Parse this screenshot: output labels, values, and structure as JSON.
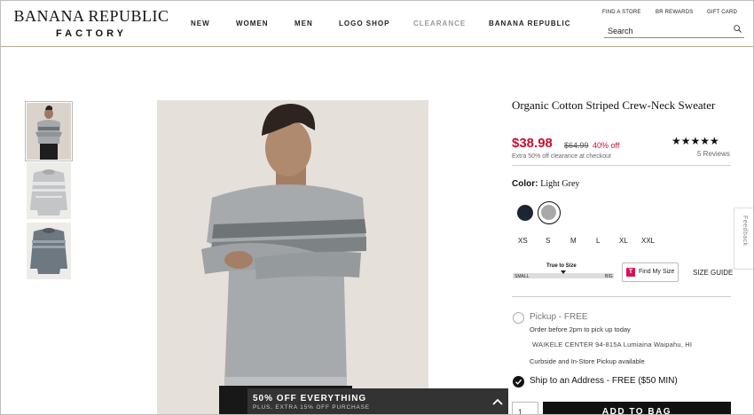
{
  "brand": {
    "line1": "BANANA REPUBLIC",
    "line2": "FACTORY"
  },
  "nav": {
    "items": [
      "NEW",
      "WOMEN",
      "MEN",
      "LOGO SHOP",
      "CLEARANCE",
      "BANANA REPUBLIC"
    ]
  },
  "utility": {
    "find_store": "FIND A STORE",
    "rewards": "BR REWARDS",
    "gift_card": "GIFT CARD"
  },
  "search": {
    "placeholder": "Search",
    "icon": "search-icon"
  },
  "product": {
    "title": "Organic Cotton Striped Crew-Neck Sweater",
    "price": "$38.98",
    "original_price": "$64.99",
    "discount": "40% off",
    "extra_offer": "Extra 50% off clearance at checkout",
    "stars": "★★★★★",
    "reviews": "5 Reviews",
    "color_label": "Color:",
    "color_value": "Light Grey",
    "swatches": [
      {
        "name": "Navy",
        "color": "#1c2533",
        "selected": false
      },
      {
        "name": "Light Grey",
        "color": "#a9a9a9",
        "selected": true
      }
    ],
    "sizes": [
      "XS",
      "S",
      "M",
      "L",
      "XL",
      "XXL"
    ],
    "fit": {
      "label": "True to Size",
      "small": "SMALL",
      "big": "BIG",
      "level": 0.5
    },
    "find_my_size": "Find My Size",
    "size_guide": "SIZE GUIDE"
  },
  "fulfillment": {
    "pickup_title": "Pickup - FREE",
    "pickup_note": "Order before 2pm to pick up today",
    "pickup_store": "WAIKELE CENTER 94-815A Lumiaina Waipahu, HI",
    "pickup_option": "Curbside and In-Store Pickup available",
    "ship_title": "Ship to an Address - FREE ($50 MIN)"
  },
  "purchase": {
    "qty": "1",
    "add_to_bag": "ADD TO BAG"
  },
  "promo": {
    "title": "50% OFF EVERYTHING",
    "subtitle": "PLUS, EXTRA 15% OFF PURCHASE"
  },
  "feedback": "Feedback",
  "colors": {
    "sale_red": "#c8102e",
    "header_rule": "#b7a98c",
    "promo_bg": "#333333",
    "button_bg": "#111111"
  }
}
